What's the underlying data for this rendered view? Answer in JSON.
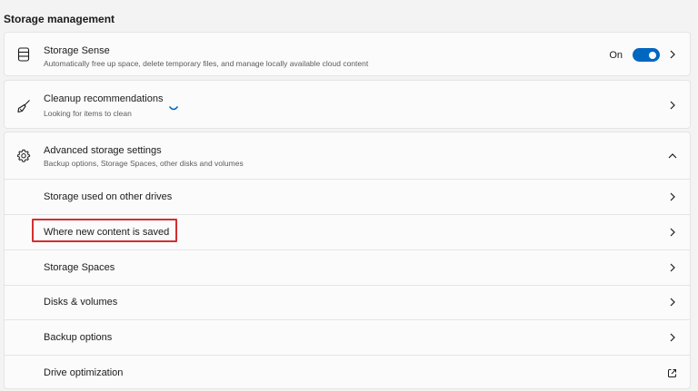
{
  "section": {
    "title": "Storage management"
  },
  "storage_sense": {
    "title": "Storage Sense",
    "subtitle": "Automatically free up space, delete temporary files, and manage locally available cloud content",
    "toggle_label": "On",
    "toggle_state": "on",
    "icon": "storage-drive-icon"
  },
  "cleanup": {
    "title": "Cleanup recommendations",
    "subtitle": "Looking for items to clean",
    "icon": "broom-icon"
  },
  "advanced": {
    "title": "Advanced storage settings",
    "subtitle": "Backup options, Storage Spaces, other disks and volumes",
    "icon": "gear-icon",
    "expanded": true,
    "items": [
      {
        "label": "Storage used on other drives",
        "trailing": "chevron-right-icon"
      },
      {
        "label": "Where new content is saved",
        "trailing": "chevron-right-icon",
        "highlighted": true
      },
      {
        "label": "Storage Spaces",
        "trailing": "chevron-right-icon"
      },
      {
        "label": "Disks & volumes",
        "trailing": "chevron-right-icon"
      },
      {
        "label": "Backup options",
        "trailing": "chevron-right-icon"
      },
      {
        "label": "Drive optimization",
        "trailing": "external-link-icon"
      }
    ]
  },
  "colors": {
    "accent": "#0067c0",
    "highlight": "#d32f2f",
    "background": "#f3f3f3",
    "card": "#fbfbfb"
  }
}
